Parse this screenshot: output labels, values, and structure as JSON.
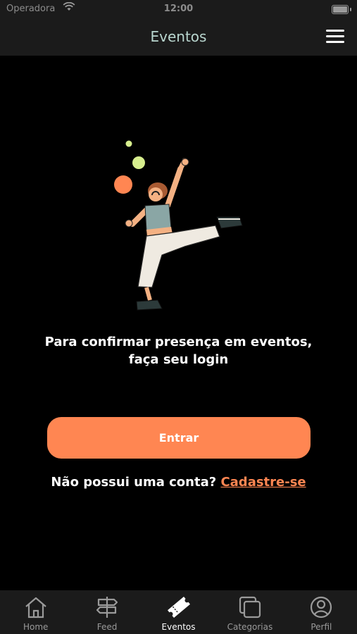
{
  "status_bar": {
    "carrier": "Operadora",
    "time": "12:00"
  },
  "navbar": {
    "title": "Eventos"
  },
  "main": {
    "message_line1": "Para confirmar presença em eventos,",
    "message_line2": "faça seu login",
    "enter_label": "Entrar",
    "signup_prompt": "Não possui uma conta?",
    "signup_link": "Cadastre-se"
  },
  "tabbar": {
    "tabs": [
      {
        "label": "Home",
        "icon": "home-icon"
      },
      {
        "label": "Feed",
        "icon": "signpost-icon"
      },
      {
        "label": "Eventos",
        "icon": "ticket-icon",
        "active": true
      },
      {
        "label": "Categorias",
        "icon": "layers-icon"
      },
      {
        "label": "Perfil",
        "icon": "user-icon"
      }
    ]
  },
  "colors": {
    "accent": "#ff8652",
    "title": "#b9d6cf",
    "bar_bg": "#1b1b1b",
    "background": "#000000"
  }
}
